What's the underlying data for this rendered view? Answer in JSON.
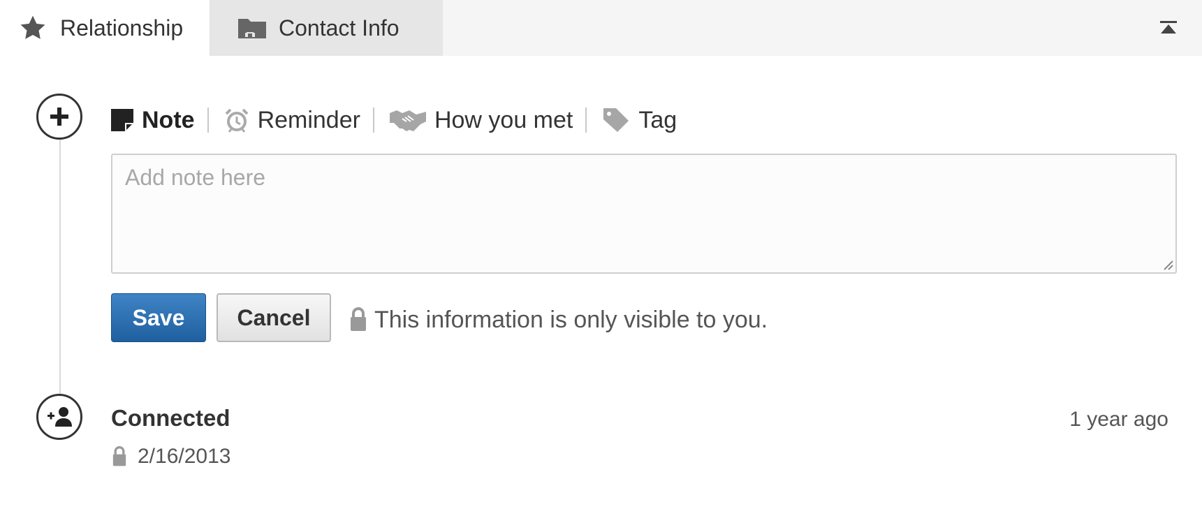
{
  "tabs": [
    {
      "label": "Relationship",
      "icon": "star-icon",
      "active": true
    },
    {
      "label": "Contact Info",
      "icon": "folder-card-icon",
      "active": false
    }
  ],
  "collapse_icon": "collapse-up-icon",
  "actions": {
    "note": {
      "label": "Note",
      "icon": "note-icon"
    },
    "reminder": {
      "label": "Reminder",
      "icon": "alarm-clock-icon"
    },
    "how_met": {
      "label": "How you met",
      "icon": "handshake-icon"
    },
    "tag": {
      "label": "Tag",
      "icon": "tag-icon"
    }
  },
  "note_input": {
    "placeholder": "Add note here",
    "value": ""
  },
  "buttons": {
    "save": "Save",
    "cancel": "Cancel"
  },
  "privacy_text": "This information is only visible to you.",
  "timeline": {
    "connected": {
      "title": "Connected",
      "date": "2/16/2013",
      "relative_time": "1 year ago"
    }
  },
  "colors": {
    "save_button": "#2a6db0",
    "tab_bar_bg": "#f5f5f5",
    "inactive_tab_bg": "#e6e6e6",
    "text_dark": "#333333",
    "icon_gray": "#999999"
  }
}
